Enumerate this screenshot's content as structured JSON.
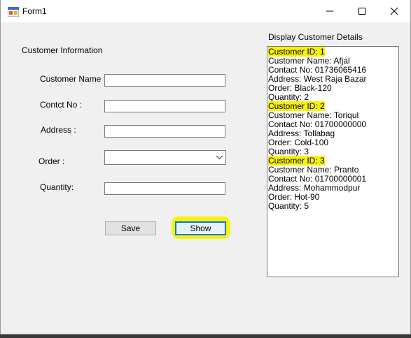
{
  "window": {
    "title": "Form1",
    "controls": {
      "minimize": "—",
      "maximize": "☐",
      "close": "✕"
    }
  },
  "group": {
    "title": "Customer Information"
  },
  "form": {
    "name_label": "Customer Name :",
    "contact_label": "Contct No :",
    "address_label": "Address :",
    "order_label": "Order :",
    "quantity_label": "Quantity:",
    "name_value": "",
    "contact_value": "",
    "address_value": "",
    "order_value": "",
    "quantity_value": ""
  },
  "buttons": {
    "save": "Save",
    "show": "Show"
  },
  "details": {
    "title": "Display Customer Details",
    "lines": [
      "Customer ID: 1",
      "Customer Name: Afjal",
      "Contact No: 01736065416",
      "Address: West Raja Bazar",
      "Order: Black-120",
      "Quantity: 2",
      "Customer ID: 2",
      "Customer Name: Toriqul",
      "Contact No: 01700000000",
      "Address: Tollabag",
      "Order: Cold-100",
      "Quantity: 3",
      "Customer ID: 3",
      "Customer Name: Pranto",
      "Contact No: 01700000001",
      "Address: Mohammodpur",
      "Order: Hot-90",
      "Quantity: 5"
    ]
  },
  "colors": {
    "highlight": "#f6f20a",
    "accent": "#0078d7"
  }
}
